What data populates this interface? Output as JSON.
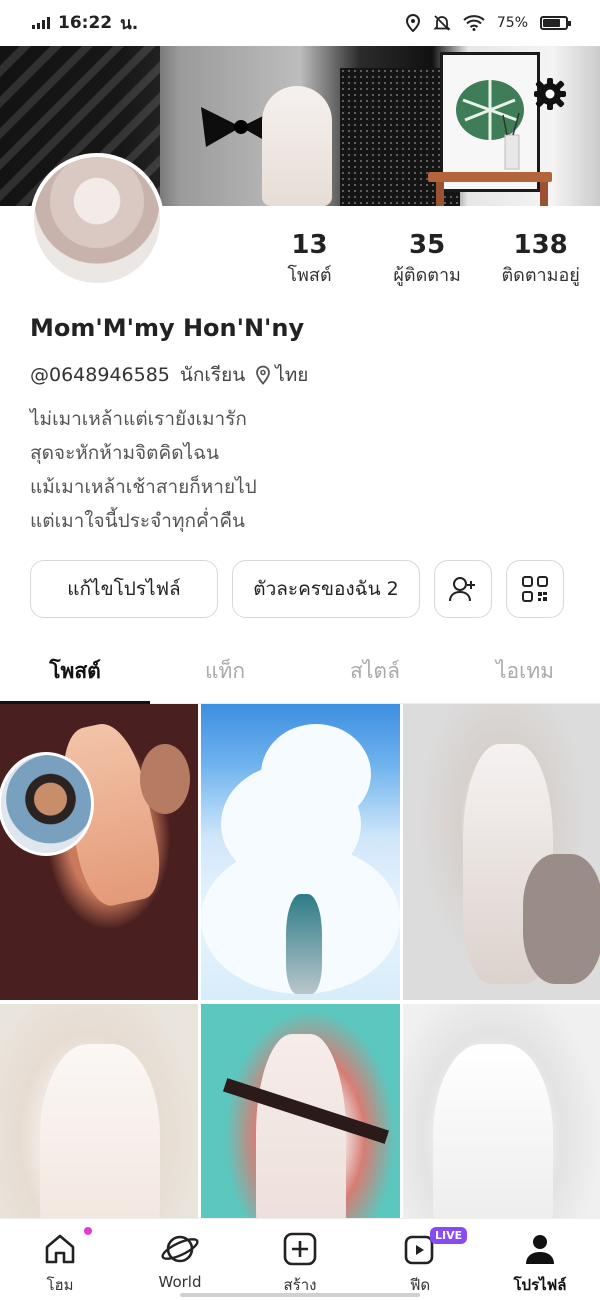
{
  "status_bar": {
    "time": "16:22",
    "carrier_suffix": "น.",
    "battery": "75%"
  },
  "profile": {
    "display_name": "Mom'M'my Hon'N'ny",
    "handle": "@0648946585",
    "role": "นักเรียน",
    "location": "ไทย",
    "bio_lines": [
      "ไม่เมาเหล้าแต่เรายังเมารัก",
      "สุดจะหักห้ามจิตคิดไฉน",
      "แม้เมาเหล้าเช้าสายก็หายไป",
      "แต่เมาใจนี้ประจำทุกค่ำคืน"
    ]
  },
  "stats": [
    {
      "value": "13",
      "label": "โพสต์"
    },
    {
      "value": "35",
      "label": "ผู้ติดตาม"
    },
    {
      "value": "138",
      "label": "ติดตามอยู่"
    }
  ],
  "actions": {
    "edit_profile": "แก้ไขโปรไฟล์",
    "my_characters": "ตัวละครของฉัน 2"
  },
  "tabs": [
    {
      "label": "โพสต์",
      "active": true
    },
    {
      "label": "แท็ก",
      "active": false
    },
    {
      "label": "สไตล์",
      "active": false
    },
    {
      "label": "ไอเทม",
      "active": false
    }
  ],
  "bottom_nav": [
    {
      "label": "โฮม",
      "icon": "home-icon"
    },
    {
      "label": "World",
      "icon": "planet-icon"
    },
    {
      "label": "สร้าง",
      "icon": "plus-square-icon"
    },
    {
      "label": "ฟีด",
      "icon": "video-icon",
      "badge": "LIVE"
    },
    {
      "label": "โปรไฟล์",
      "icon": "person-icon",
      "active": true
    }
  ],
  "colors": {
    "accent_live": "#8a4af3",
    "notification_dot": "#e43ad7",
    "text_primary": "#222222"
  }
}
